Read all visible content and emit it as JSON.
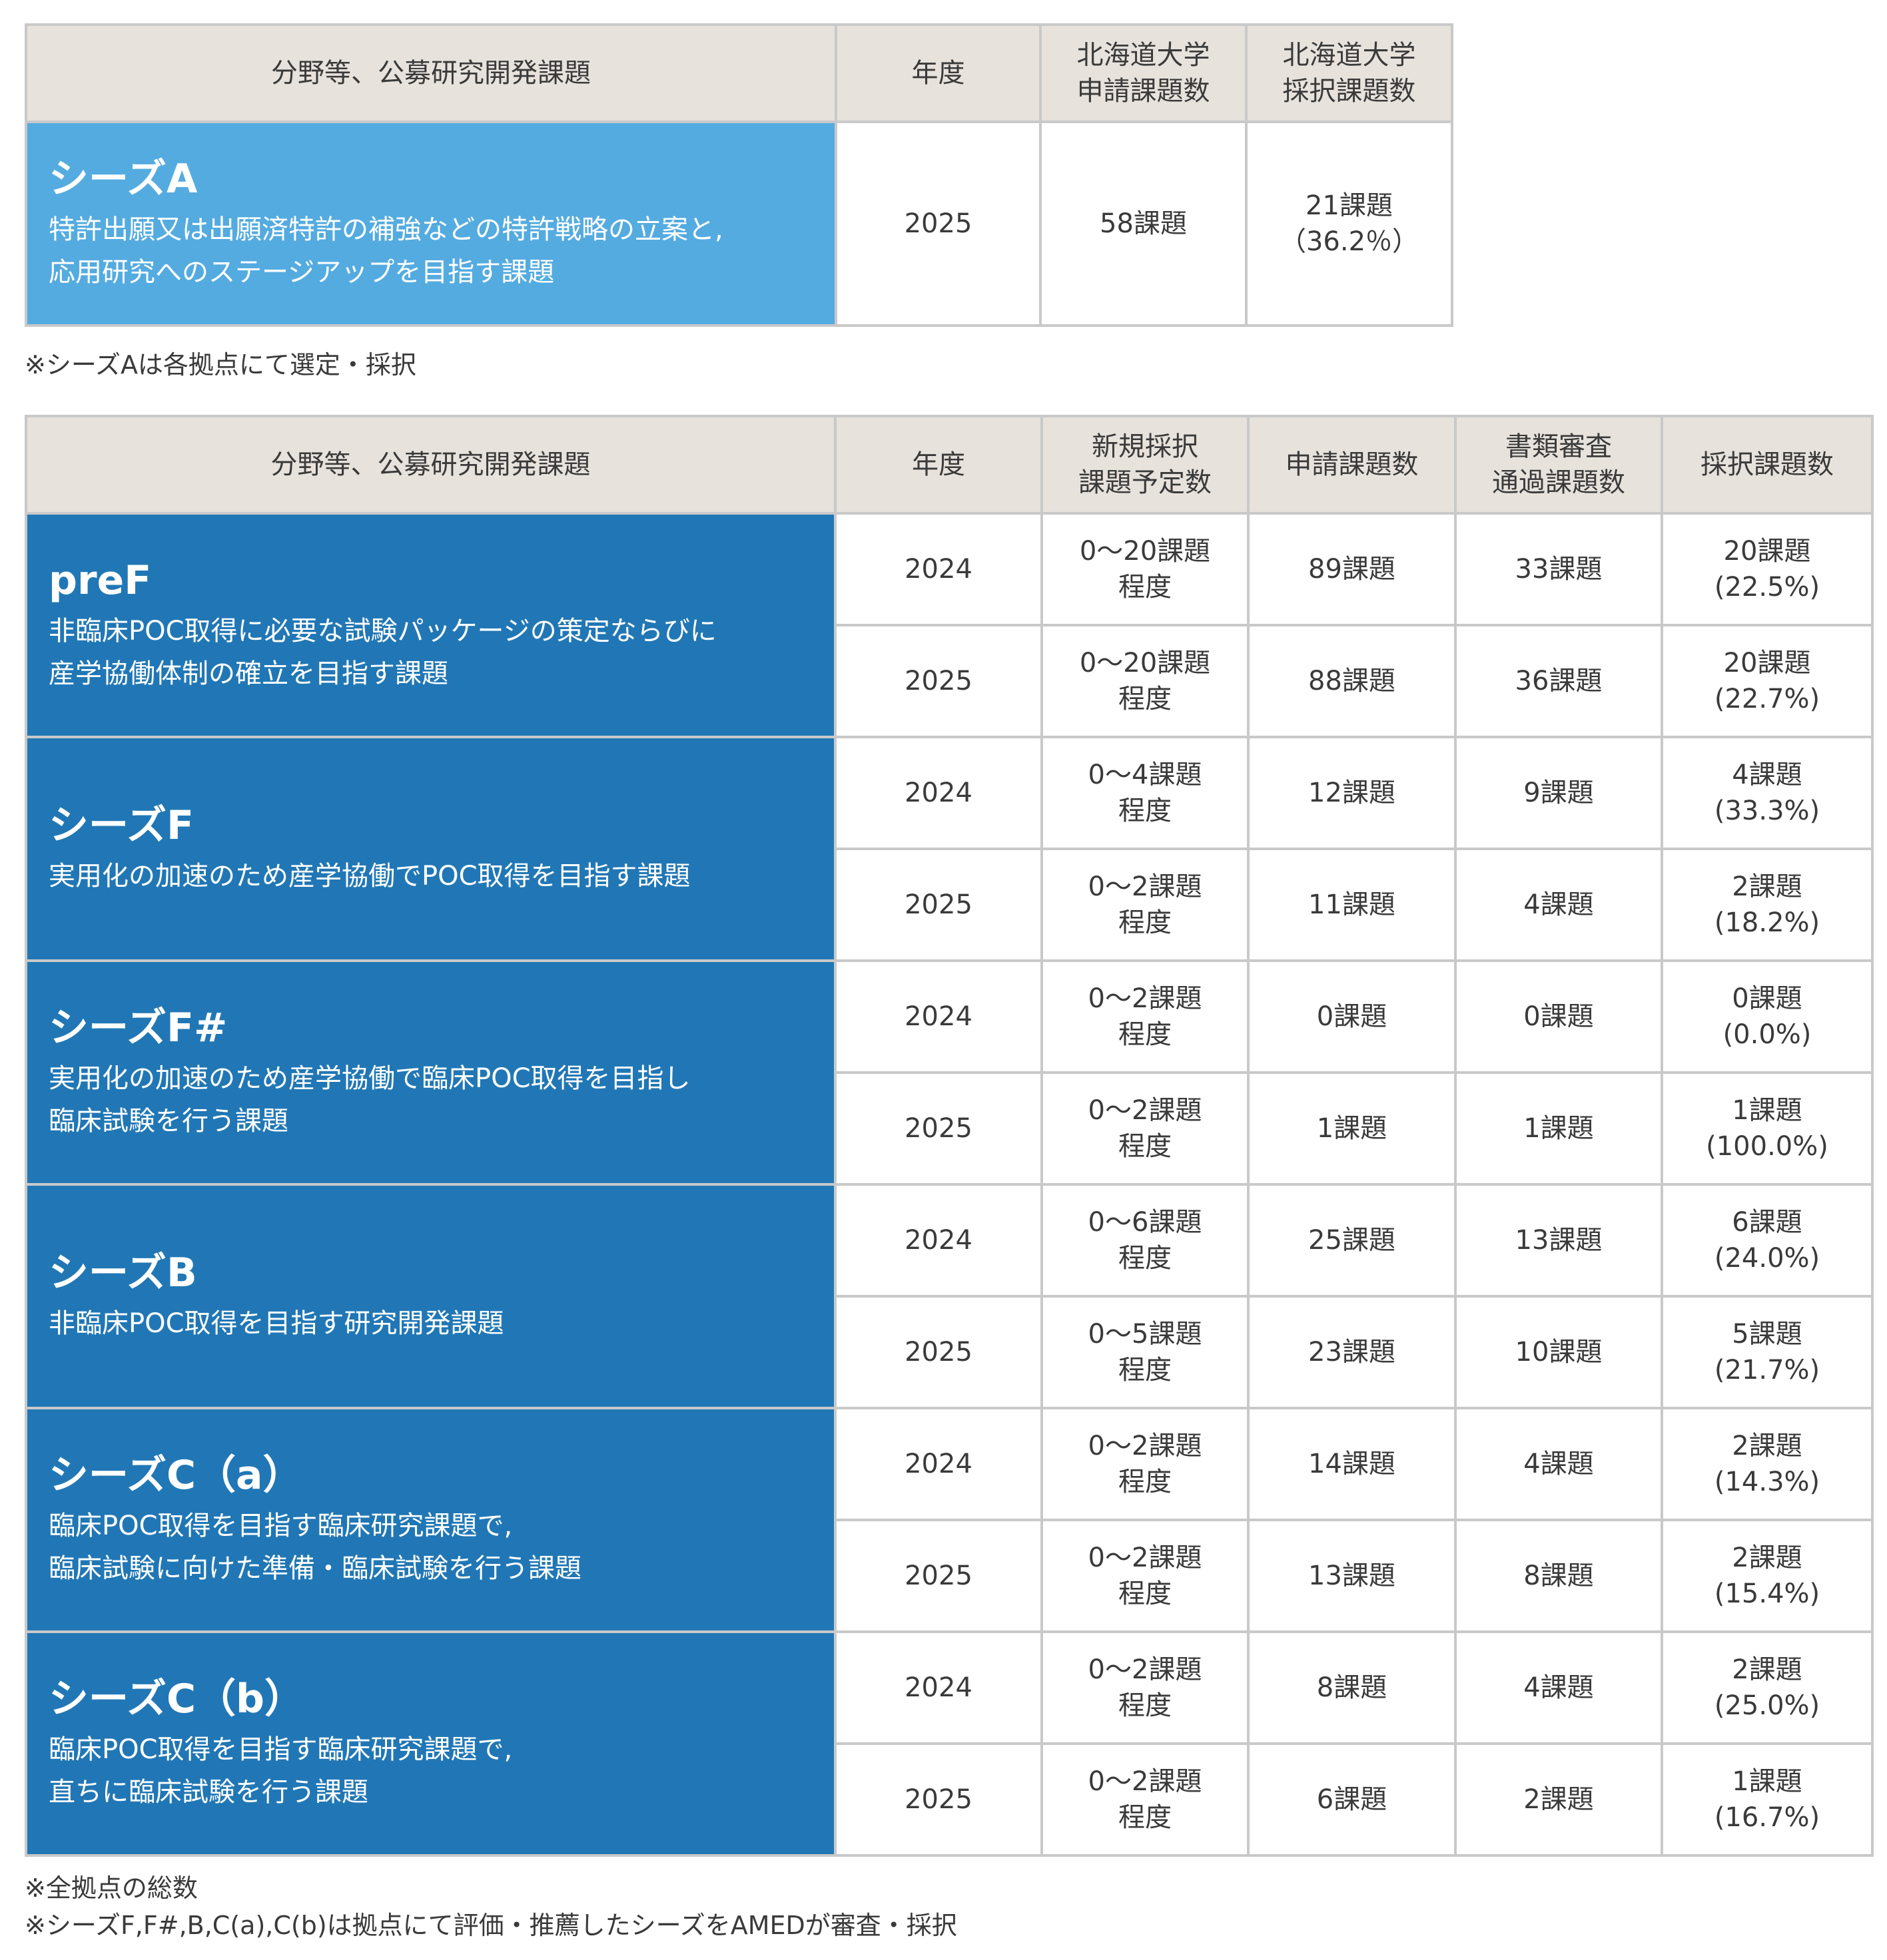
{
  "table_a": {
    "headers": [
      "分野等、公募研究開発課題",
      "年度",
      "北海道大学\n申請課題数",
      "北海道大学\n採択課題数"
    ],
    "row": {
      "title": "シーズA",
      "desc": "特許出願又は出願済特許の補強などの特許戦略の立案と,\n応用研究へのステージアップを目指す課題",
      "year": "2025",
      "applied": "58課題",
      "adopted": "21課題\n（36.2％）"
    },
    "note": "※シーズAは各拠点にて選定・採択"
  },
  "table_b": {
    "headers": [
      "分野等、公募研究開発課題",
      "年度",
      "新規採択\n課題予定数",
      "申請課題数",
      "書類審査\n通過課題数",
      "採択課題数"
    ],
    "groups": [
      {
        "title": "preF",
        "desc": "非臨床POC取得に必要な試験パッケージの策定ならびに\n産学協働体制の確立を目指す課題",
        "rows": [
          {
            "year": "2024",
            "planned": "0～20課題\n程度",
            "applied": "89課題",
            "passed": "33課題",
            "adopted": "20課題\n(22.5%)"
          },
          {
            "year": "2025",
            "planned": "0～20課題\n程度",
            "applied": "88課題",
            "passed": "36課題",
            "adopted": "20課題\n(22.7%)"
          }
        ]
      },
      {
        "title": "シーズF",
        "desc": "実用化の加速のため産学協働でPOC取得を目指す課題",
        "rows": [
          {
            "year": "2024",
            "planned": "0～4課題\n程度",
            "applied": "12課題",
            "passed": "9課題",
            "adopted": "4課題\n(33.3%)"
          },
          {
            "year": "2025",
            "planned": "0～2課題\n程度",
            "applied": "11課題",
            "passed": "4課題",
            "adopted": "2課題\n(18.2%)"
          }
        ]
      },
      {
        "title": "シーズF#",
        "desc": "実用化の加速のため産学協働で臨床POC取得を目指し\n臨床試験を行う課題",
        "rows": [
          {
            "year": "2024",
            "planned": "0～2課題\n程度",
            "applied": "0課題",
            "passed": "0課題",
            "adopted": "0課題\n(0.0%)"
          },
          {
            "year": "2025",
            "planned": "0～2課題\n程度",
            "applied": "1課題",
            "passed": "1課題",
            "adopted": "1課題\n(100.0%)"
          }
        ]
      },
      {
        "title": "シーズB",
        "desc": "非臨床POC取得を目指す研究開発課題",
        "rows": [
          {
            "year": "2024",
            "planned": "0～6課題\n程度",
            "applied": "25課題",
            "passed": "13課題",
            "adopted": "6課題\n(24.0%)"
          },
          {
            "year": "2025",
            "planned": "0～5課題\n程度",
            "applied": "23課題",
            "passed": "10課題",
            "adopted": "5課題\n(21.7%)"
          }
        ]
      },
      {
        "title": "シーズC（a）",
        "desc": "臨床POC取得を目指す臨床研究課題で,\n臨床試験に向けた準備・臨床試験を行う課題",
        "rows": [
          {
            "year": "2024",
            "planned": "0～2課題\n程度",
            "applied": "14課題",
            "passed": "4課題",
            "adopted": "2課題\n(14.3%)"
          },
          {
            "year": "2025",
            "planned": "0～2課題\n程度",
            "applied": "13課題",
            "passed": "8課題",
            "adopted": "2課題\n(15.4%)"
          }
        ]
      },
      {
        "title": "シーズC（b）",
        "desc": "臨床POC取得を目指す臨床研究課題で,\n直ちに臨床試験を行う課題",
        "rows": [
          {
            "year": "2024",
            "planned": "0～2課題\n程度",
            "applied": "8課題",
            "passed": "4課題",
            "adopted": "2課題\n(25.0%)"
          },
          {
            "year": "2025",
            "planned": "0～2課題\n程度",
            "applied": "6課題",
            "passed": "2課題",
            "adopted": "1課題\n(16.7%)"
          }
        ]
      }
    ],
    "notes": [
      "※全拠点の総数",
      "※シーズF,F#,B,C(a),C(b)は拠点にて評価・推薦したシーズをAMEDが審査・採択"
    ]
  }
}
